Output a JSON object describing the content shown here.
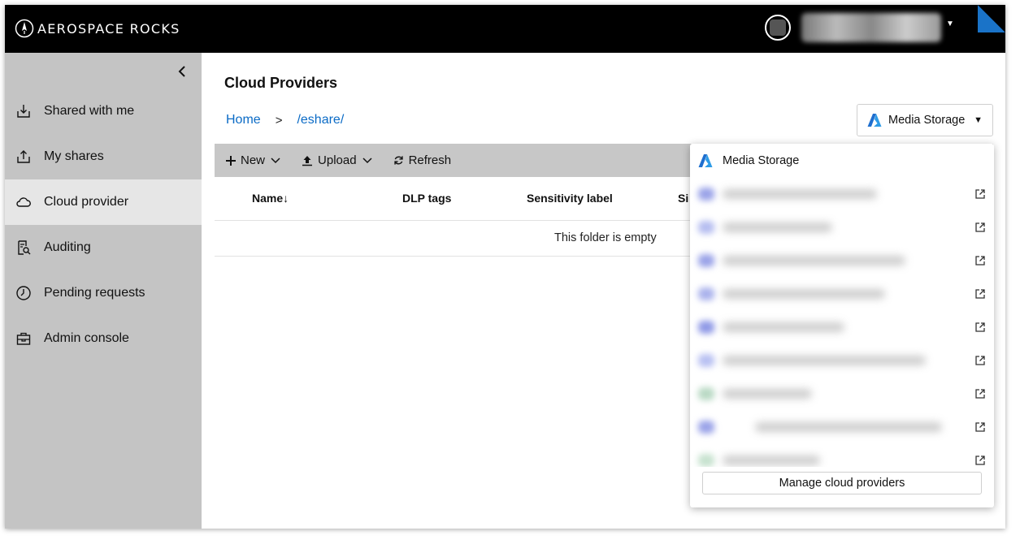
{
  "brand": {
    "name": "AEROSPACE ROCKS",
    "logo_icon": "rocket-icon"
  },
  "header": {
    "avatar_icon": "avatar-icon",
    "user_menu_icon": "caret-down-icon"
  },
  "sidebar": {
    "collapse_icon": "chevron-left-icon",
    "items": [
      {
        "label": "Shared with me",
        "icon": "inbox-download-icon",
        "active": false
      },
      {
        "label": "My shares",
        "icon": "share-upload-icon",
        "active": false
      },
      {
        "label": "Cloud provider",
        "icon": "cloud-icon",
        "active": true
      },
      {
        "label": "Auditing",
        "icon": "audit-search-icon",
        "active": false
      },
      {
        "label": "Pending requests",
        "icon": "clock-icon",
        "active": false
      },
      {
        "label": "Admin console",
        "icon": "briefcase-icon",
        "active": false
      }
    ]
  },
  "main": {
    "title": "Cloud Providers",
    "breadcrumb": {
      "home": "Home",
      "separator": ">",
      "path": "/eshare/"
    },
    "storage_selector": {
      "selected": "Media Storage",
      "icon": "azure-icon"
    },
    "toolbar": {
      "new_label": "New",
      "upload_label": "Upload",
      "refresh_label": "Refresh"
    },
    "table": {
      "columns": [
        "Name",
        "DLP tags",
        "Sensitivity label",
        "Si"
      ],
      "sort_indicator": "↓",
      "empty_message": "This folder is empty"
    }
  },
  "dropdown": {
    "header_label": "Media Storage",
    "items_blurred": 9,
    "manage_label": "Manage cloud providers"
  },
  "colors": {
    "link": "#0b6bc6",
    "topbar": "#000000",
    "sidebar": "#c4c4c4",
    "sidebar_active": "#e6e6e6",
    "toolbar": "#c7c7c7"
  }
}
